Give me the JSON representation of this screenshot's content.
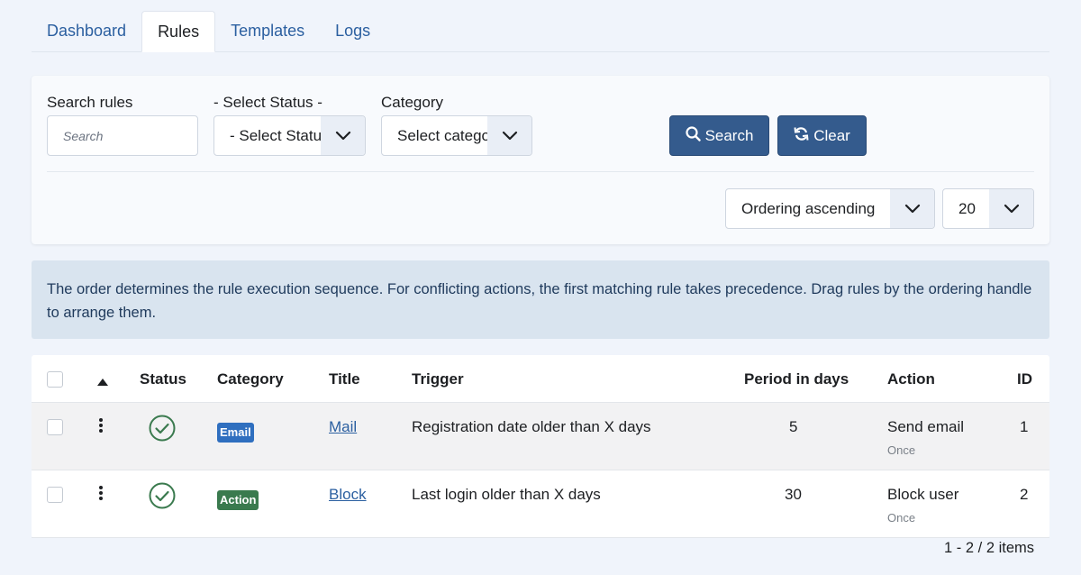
{
  "tabs": [
    {
      "label": "Dashboard",
      "active": false
    },
    {
      "label": "Rules",
      "active": true
    },
    {
      "label": "Templates",
      "active": false
    },
    {
      "label": "Logs",
      "active": false
    }
  ],
  "filters": {
    "search_label": "Search rules",
    "search_placeholder": "Search",
    "status_label": "- Select Status -",
    "status_value": "- Select Status -",
    "category_label": "Category",
    "category_value": "Select category",
    "search_button": "Search",
    "clear_button": "Clear",
    "ordering_value": "Ordering ascending",
    "limit_value": "20"
  },
  "alert": {
    "text": "The order determines the rule execution sequence. For conflicting actions, the first matching rule takes precedence. Drag rules by the ordering handle to arrange them."
  },
  "table": {
    "headers": {
      "status": "Status",
      "category": "Category",
      "title": "Title",
      "trigger": "Trigger",
      "period": "Period in days",
      "action": "Action",
      "id": "ID"
    },
    "rows": [
      {
        "category": "Email",
        "category_color": "#2f6fbf",
        "title": "Mail",
        "trigger": "Registration date older than X days",
        "period": "5",
        "action": "Send email",
        "frequency": "Once",
        "id": "1"
      },
      {
        "category": "Action",
        "category_color": "#3a7a4e",
        "title": "Block",
        "trigger": "Last login older than X days",
        "period": "30",
        "action": "Block user",
        "frequency": "Once",
        "id": "2"
      }
    ]
  },
  "pagination": {
    "count": "1 - 2 / 2 items"
  },
  "colors": {
    "primary_button": "#345b8d",
    "link": "#2b5fa0",
    "status_ok": "#3a7a4e"
  }
}
